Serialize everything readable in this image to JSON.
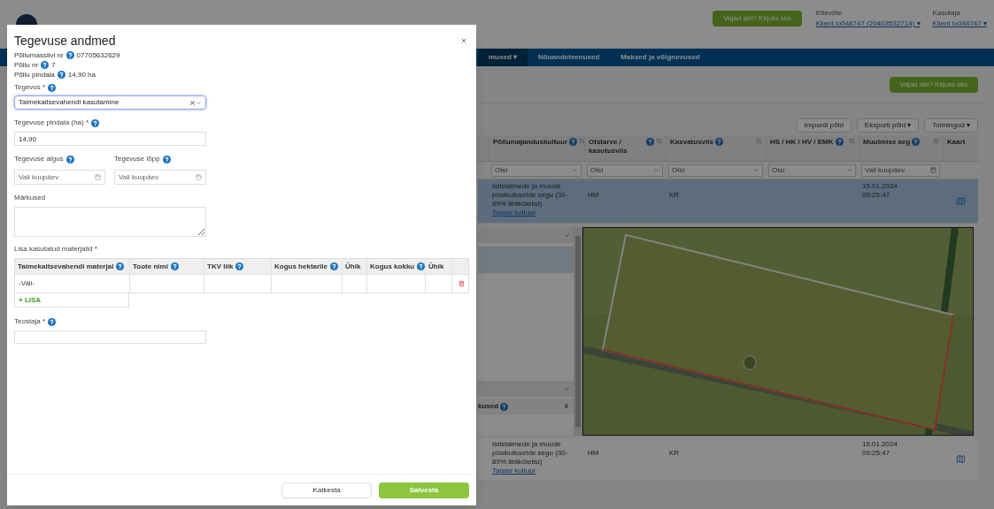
{
  "background_page": {
    "help_button": "Vajad abi? Kirjuta siia",
    "company": {
      "label": "Ettevõte",
      "value": "Klient lo048747 (20403532714) ▾"
    },
    "user": {
      "label": "Kasutaja",
      "value": "Klient lo048747 ▾"
    },
    "nav": [
      {
        "label": "mused ▾",
        "selected": true
      },
      {
        "label": "Nõuandeteenused",
        "selected": false
      },
      {
        "label": "Maksed ja võlgnevused",
        "selected": false
      }
    ],
    "help_button_2": "Vajad abi? Kirjuta siia",
    "toolbar_buttons": [
      "Impordi põld",
      "Eksporti põld ▾",
      "Toimingud ▾"
    ],
    "table": {
      "columns": [
        {
          "label": "Põllumajanduskultuur",
          "help": true,
          "sortable": true
        },
        {
          "label": "Otstarve / kasutusviis",
          "help": true,
          "sortable": true
        },
        {
          "label": "Kasvatusviis",
          "help": true,
          "sortable": true
        },
        {
          "label": "HS / HK / HV / EMK",
          "help": true,
          "sortable": true
        },
        {
          "label": "Muutmise aeg",
          "help": true,
          "sortable": true
        },
        {
          "label": "Kaart",
          "help": false,
          "sortable": false
        }
      ],
      "filters": [
        {
          "kind": "select",
          "placeholder": "Otsi"
        },
        {
          "kind": "select",
          "placeholder": "Otsi"
        },
        {
          "kind": "select",
          "placeholder": "Otsi"
        },
        {
          "kind": "select",
          "placeholder": "Otsi"
        },
        {
          "kind": "date",
          "placeholder": "Vali kuupäev"
        },
        {
          "kind": "none"
        }
      ],
      "rows": [
        {
          "selected": true,
          "crop": "Ististaimede ja muude püsikultuuride segu (30-89% liblikõielisi)",
          "link": "Tagasi kultuur",
          "purpose": "HM",
          "method": "KR",
          "codes": "",
          "modified": "15.01.2024 09:25:47"
        },
        {
          "selected": false,
          "crop": "Ististaimede ja muude püsikultuuride segu (30-89% liblikõielisi)",
          "link": "Tagasi kultuur",
          "purpose": "HM",
          "method": "KR",
          "codes": "",
          "modified": "15.01.2024 09:25:47"
        }
      ]
    },
    "side_panel": {
      "label": "kused",
      "count": "4"
    }
  },
  "dialog": {
    "title": "Tegevuse andmed",
    "info": [
      {
        "label": "Põllumassiivi nr",
        "value": "07705632629"
      },
      {
        "label": "Põllu nr",
        "value": "7"
      },
      {
        "label": "Põllu pindala",
        "value": "14,90 ha"
      }
    ],
    "activity": {
      "label": "Tegevus *",
      "value": "Taimekaitsevahendi kasutamine",
      "focused": true
    },
    "area": {
      "label": "Tegevuse pindala (ha) *",
      "value": "14,90"
    },
    "start": {
      "label": "Tegevuse algus",
      "placeholder": "Vali kuupäev"
    },
    "end": {
      "label": "Tegevuse lõpp",
      "placeholder": "Vali kuupäev"
    },
    "notes": {
      "label": "Märkused"
    },
    "materials": {
      "label": "Lisa kasutatud materjalid *",
      "columns": [
        {
          "label": "Taimekaitsevahendi materjal",
          "help": true
        },
        {
          "label": "Toote nimi",
          "help": true
        },
        {
          "label": "TKV liik",
          "help": true
        },
        {
          "label": "Kogus hektarile",
          "help": true
        },
        {
          "label": "Ühik",
          "help": false
        },
        {
          "label": "Kogus kokku",
          "help": true
        },
        {
          "label": "Ühik",
          "help": false
        }
      ],
      "rows": [
        [
          "-Vali-",
          "",
          "",
          "",
          "",
          "",
          ""
        ]
      ],
      "add": "+ LISA"
    },
    "performer": {
      "label": "Teostaja *"
    },
    "buttons": [
      {
        "kind": "secondary",
        "label": "Katkesta"
      },
      {
        "kind": "primary",
        "label": "Salvesta"
      }
    ]
  }
}
